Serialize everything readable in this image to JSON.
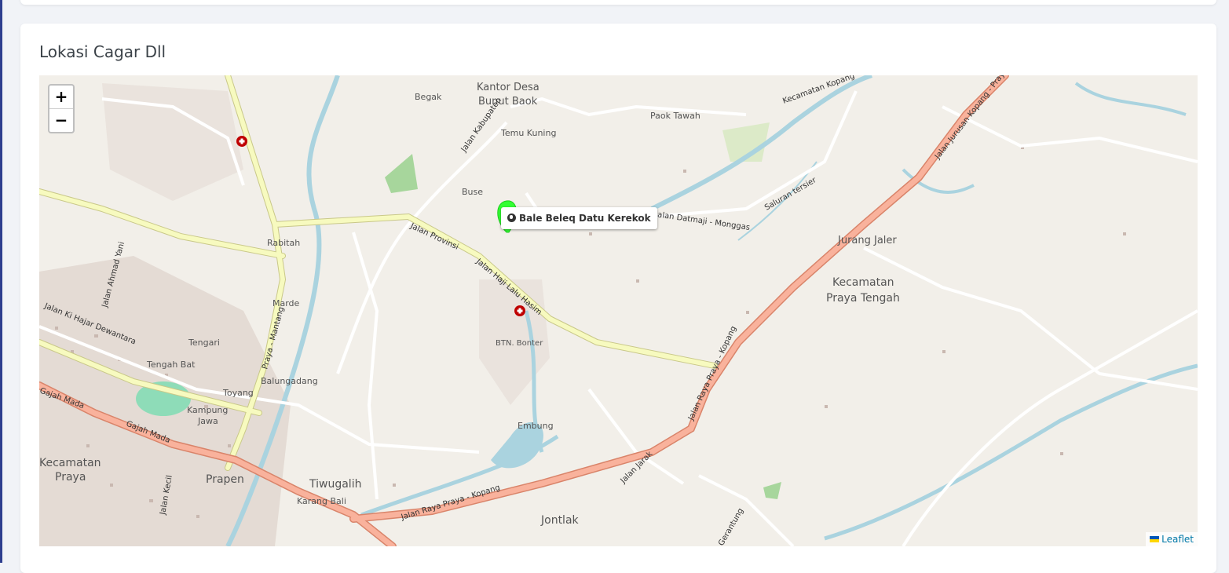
{
  "section": {
    "title": "Lokasi Cagar Dll"
  },
  "map": {
    "zoom_in": "+",
    "zoom_out": "−",
    "marker": {
      "label": "Bale Beleq Datu Kerekok",
      "color": "#33ff33"
    },
    "attribution": "Leaflet",
    "places": {
      "kantor_desa": "Kantor Desa",
      "bunut_baok": "Bunut Baok",
      "begak": "Begak",
      "paok_tawah": "Paok Tawah",
      "temu_kuning": "Temu Kuning",
      "buse": "Buse",
      "rabitah": "Rabitah",
      "marde": "Marde",
      "tengari": "Tengari",
      "tengah_bat": "Tengah Bat",
      "balungadang": "Balungadang",
      "toyang": "Toyang",
      "kampung": "Kampung",
      "jawa": "Jawa",
      "btn_bonter": "BTN. Bonter",
      "embung": "Embung",
      "jurang_jaler": "Jurang Jaler",
      "kec_praya_tengah_1": "Kecamatan",
      "kec_praya_tengah_2": "Praya Tengah",
      "kec_praya_1": "Kecamatan",
      "kec_praya_2": "Praya",
      "prapen": "Prapen",
      "tiwugalih": "Tiwugalih",
      "karang_bali": "Karang Bali",
      "jontlak": "Jontlak"
    },
    "roads": {
      "jalan_kabupaten": "Jalan Kabupaten",
      "jalan_provinsi": "Jalan Provinsi",
      "jalan_haji": "Jalan Haji Lalu Hasim",
      "jalan_datmaji": "Jalan Datmaji - Monggas",
      "saluran": "Saluran tersier",
      "kecamatan_kopang": "Kecamatan Kopang",
      "jalan_jurusan": "Jalan Jurusan Kopang - Praya",
      "jalan_raya_kopang": "Jalan Raya Praya - Kopang",
      "jalan_raya_praya": "Jalan Raya Praya - Kopang",
      "praya_mantang": "Praya - Mantang",
      "jalan_ahmad_yani": "Jalan Ahmad Yani",
      "jalan_hajar": "Jalan Ki Hajar Dewantara",
      "gajah_mada_1": "Gajah Mada",
      "gajah_mada_2": "Gajah Mada",
      "jalan_jarak": "Jalan Jarak",
      "jalan_kecil": "Jalan Kecil",
      "gerantung": "Gerantung"
    }
  }
}
